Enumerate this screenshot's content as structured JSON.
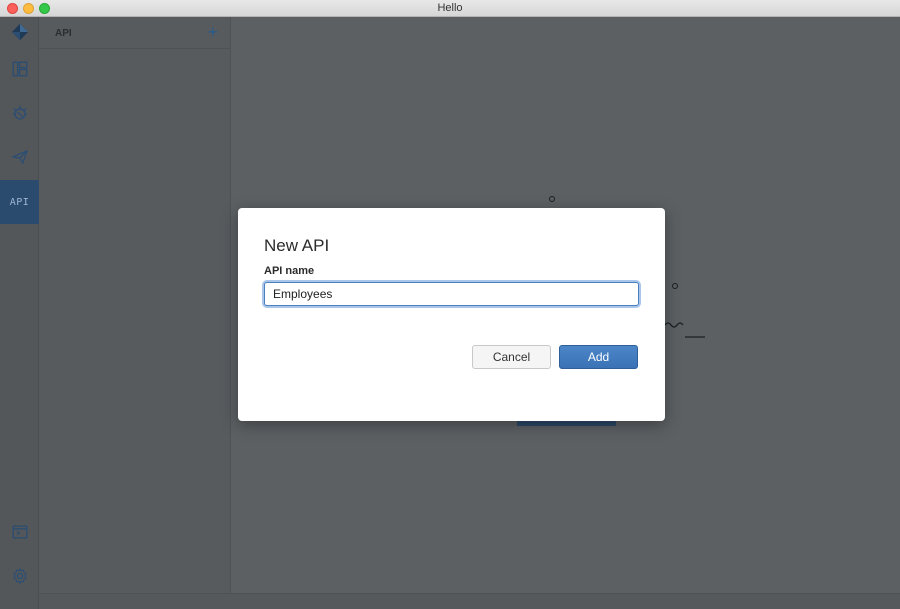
{
  "window": {
    "title": "Hello"
  },
  "rail": {
    "items": [
      {
        "icon": "dashboard-icon"
      },
      {
        "icon": "bug-icon"
      },
      {
        "icon": "send-icon"
      },
      {
        "icon": "api-icon",
        "label": "API",
        "active": true
      },
      {
        "icon": "terminal-icon"
      },
      {
        "icon": "gear-icon"
      }
    ]
  },
  "panel": {
    "title": "API",
    "add_label": "+"
  },
  "modal": {
    "title": "New API",
    "field_label": "API name",
    "field_value": "Employees",
    "cancel_label": "Cancel",
    "add_label": "Add"
  },
  "colors": {
    "accent": "#3a72b5",
    "rail_active": "#2a4b6e",
    "overlay": "#5c6063"
  }
}
